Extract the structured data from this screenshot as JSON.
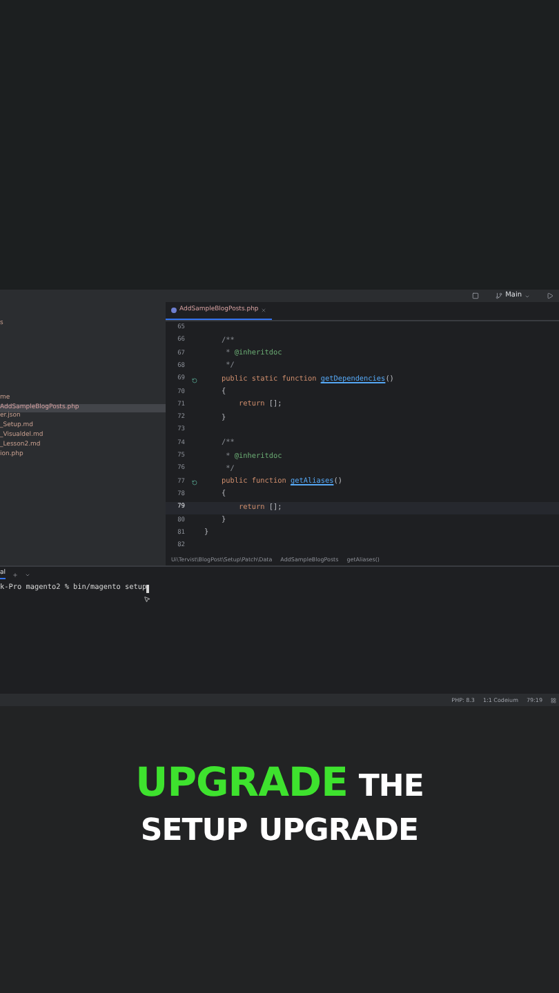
{
  "toolbar": {
    "branch": "Main"
  },
  "project_tree": {
    "items": [
      {
        "label": "s",
        "selected": false
      },
      {
        "label": "me",
        "selected": false
      },
      {
        "label": "AddSampleBlogPosts.php",
        "selected": true
      },
      {
        "label": "er.json",
        "selected": false
      },
      {
        "label": "_Setup.md",
        "selected": false
      },
      {
        "label": "_Visualdel.md",
        "selected": false
      },
      {
        "label": "_Lesson2.md",
        "selected": false
      },
      {
        "label": "ion.php",
        "selected": false
      }
    ]
  },
  "editor": {
    "tab": {
      "label": "AddSampleBlogPosts.php",
      "selected": true
    },
    "lines": [
      {
        "number": "65",
        "current": false,
        "marker": false
      },
      {
        "number": "66",
        "current": false,
        "marker": false,
        "segments": [
          {
            "kind": "comment",
            "text": "    /**"
          }
        ]
      },
      {
        "number": "67",
        "current": false,
        "marker": false,
        "segments": [
          {
            "kind": "comment",
            "text": "     * "
          },
          {
            "kind": "doc",
            "text": "@inheritdoc"
          }
        ]
      },
      {
        "number": "68",
        "current": false,
        "marker": false,
        "segments": [
          {
            "kind": "comment",
            "text": "     */"
          }
        ]
      },
      {
        "number": "69",
        "current": false,
        "marker": true,
        "segments": [
          {
            "kind": "keyword",
            "text": "    public static function "
          },
          {
            "kind": "function",
            "text": "getDependencies"
          },
          {
            "kind": "plain",
            "text": "()"
          }
        ]
      },
      {
        "number": "70",
        "current": false,
        "marker": false,
        "segments": [
          {
            "kind": "plain",
            "text": "    {"
          }
        ]
      },
      {
        "number": "71",
        "current": false,
        "marker": false,
        "segments": [
          {
            "kind": "keyword",
            "text": "        return "
          },
          {
            "kind": "plain",
            "text": "[];"
          }
        ]
      },
      {
        "number": "72",
        "current": false,
        "marker": false,
        "segments": [
          {
            "kind": "plain",
            "text": "    }"
          }
        ]
      },
      {
        "number": "73",
        "current": false,
        "marker": false
      },
      {
        "number": "74",
        "current": false,
        "marker": false,
        "segments": [
          {
            "kind": "comment",
            "text": "    /**"
          }
        ]
      },
      {
        "number": "75",
        "current": false,
        "marker": false,
        "segments": [
          {
            "kind": "comment",
            "text": "     * "
          },
          {
            "kind": "doc",
            "text": "@inheritdoc"
          }
        ]
      },
      {
        "number": "76",
        "current": false,
        "marker": false,
        "segments": [
          {
            "kind": "comment",
            "text": "     */"
          }
        ]
      },
      {
        "number": "77",
        "current": false,
        "marker": true,
        "segments": [
          {
            "kind": "keyword",
            "text": "    public function "
          },
          {
            "kind": "function",
            "text": "getAliases"
          },
          {
            "kind": "plain",
            "text": "()"
          }
        ]
      },
      {
        "number": "78",
        "current": false,
        "marker": false,
        "segments": [
          {
            "kind": "plain",
            "text": "    {"
          }
        ]
      },
      {
        "number": "79",
        "current": true,
        "marker": false,
        "segments": [
          {
            "kind": "keyword",
            "text": "        return "
          },
          {
            "kind": "plain",
            "text": "[];"
          }
        ]
      },
      {
        "number": "80",
        "current": false,
        "marker": false,
        "segments": [
          {
            "kind": "plain",
            "text": "    }"
          }
        ]
      },
      {
        "number": "81",
        "current": false,
        "marker": false,
        "segments": [
          {
            "kind": "plain",
            "text": "}"
          }
        ]
      },
      {
        "number": "82",
        "current": false,
        "marker": false
      }
    ],
    "breadcrumbs": [
      "Ui\\Tervist\\BlogPost\\Setup\\Patch\\Data",
      "AddSampleBlogPosts",
      "getAliases()"
    ]
  },
  "terminal": {
    "tab": "al",
    "prompt": "k-Pro magento2 %",
    "command": "bin/magento setup"
  },
  "status_bar": [
    "PHP: 8.3",
    "1:1 Codeium",
    "79:19"
  ],
  "caption": {
    "lines": [
      [
        {
          "text": "UPGRADE",
          "highlight": true
        },
        {
          "text": "THE",
          "highlight": false
        }
      ],
      [
        {
          "text": "SETUP",
          "highlight": false
        },
        {
          "text": "UPGRADE",
          "highlight": false
        }
      ]
    ]
  }
}
